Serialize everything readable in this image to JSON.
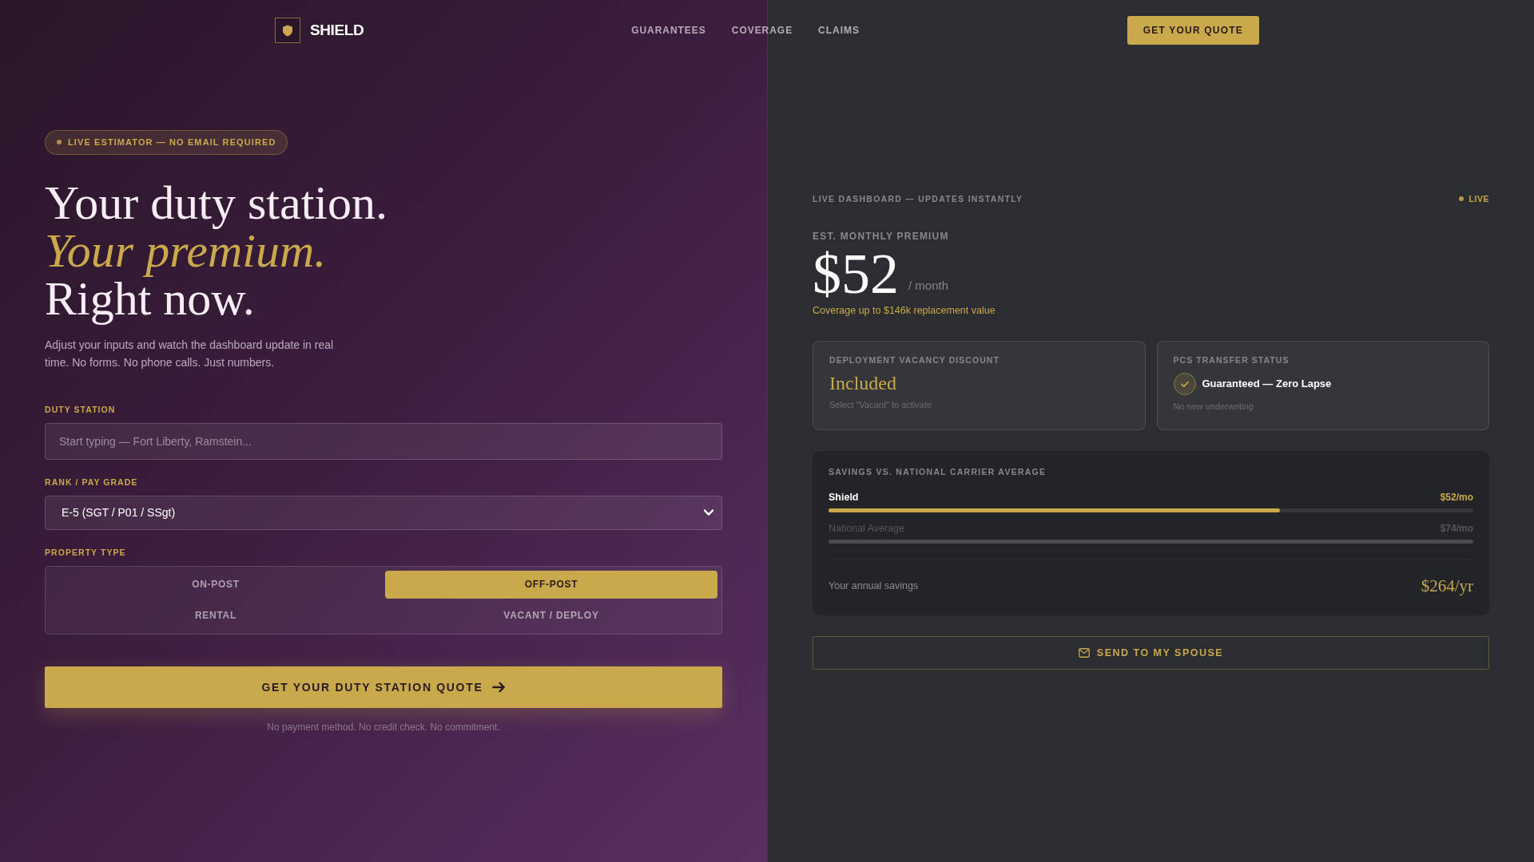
{
  "header": {
    "logo": "SHIELD",
    "nav": [
      "GUARANTEES",
      "COVERAGE",
      "CLAIMS"
    ],
    "cta": "GET YOUR QUOTE"
  },
  "hero": {
    "badge": "LIVE ESTIMATOR — NO EMAIL REQUIRED",
    "headline": [
      {
        "text": "Your duty station.",
        "kind": "plain"
      },
      {
        "text": "Your premium.",
        "kind": "accent"
      },
      {
        "text": "Right now.",
        "kind": "plain"
      }
    ],
    "intro": "Adjust your inputs and watch the dashboard update in real time. No forms. No phone calls. Just numbers."
  },
  "form": {
    "duty_station": {
      "label": "DUTY STATION",
      "placeholder": "Start typing — Fort Liberty, Ramstein..."
    },
    "rank": {
      "label": "RANK / PAY GRADE",
      "value": "E-5 (SGT / P01 / SSgt)"
    },
    "property_type": {
      "label": "PROPERTY TYPE",
      "options": [
        {
          "label": "ON-POST",
          "selected": false
        },
        {
          "label": "OFF-POST",
          "selected": true
        },
        {
          "label": "RENTAL",
          "selected": false
        },
        {
          "label": "VACANT / DEPLOY",
          "selected": false
        }
      ]
    },
    "submit": "GET YOUR DUTY STATION QUOTE",
    "note": "No payment method. No credit check. No commitment."
  },
  "dashboard": {
    "heading": "LIVE DASHBOARD — UPDATES INSTANTLY",
    "status": "LIVE",
    "premium_label": "EST. MONTHLY PREMIUM",
    "premium": "$52",
    "premium_unit": "/ month",
    "coverage_note": "Coverage up to $146k replacement value",
    "cards": [
      {
        "kind": "discount",
        "title": "DEPLOYMENT VACANCY DISCOUNT",
        "value": "Included",
        "note": "Select \"Vacant\" to activate"
      },
      {
        "kind": "status",
        "title": "PCS TRANSFER STATUS",
        "value": "Guaranteed — Zero Lapse",
        "note": "No new underwriting"
      }
    ],
    "savings": {
      "title": "SAVINGS VS. NATIONAL CARRIER AVERAGE",
      "bars": [
        {
          "kind": "primary",
          "name": "Shield",
          "amount": "$52/mo",
          "level": 0.7
        },
        {
          "kind": "muted",
          "name": "National Average",
          "amount": "$74/mo",
          "level": 1
        }
      ],
      "annual_label": "Your annual savings",
      "annual_value": "$264/yr"
    },
    "share_button": "SEND TO MY SPOUSE"
  }
}
